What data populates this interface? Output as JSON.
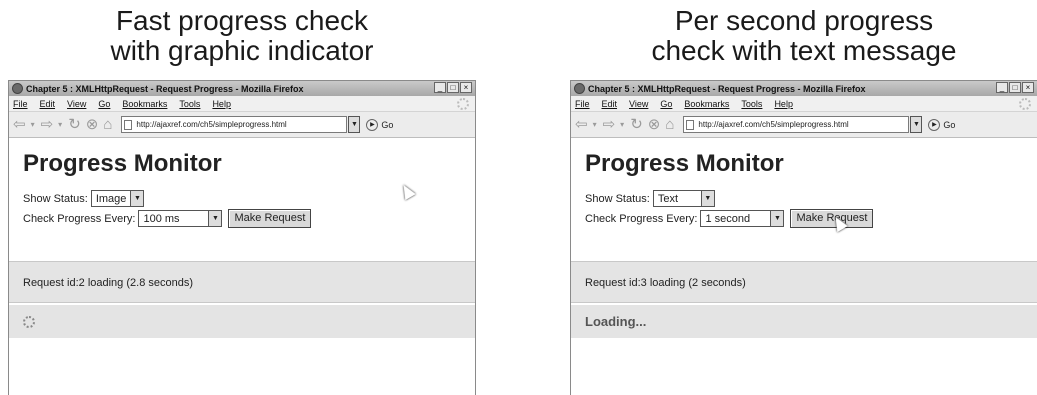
{
  "left": {
    "caption": [
      "Fast progress check",
      "with graphic indicator"
    ],
    "window_title": "Chapter 5 : XMLHttpRequest - Request Progress - Mozilla Firefox",
    "menu": [
      "File",
      "Edit",
      "View",
      "Go",
      "Bookmarks",
      "Tools",
      "Help"
    ],
    "url": "http://ajaxref.com/ch5/simpleprogress.html",
    "go_label": "Go",
    "heading": "Progress Monitor",
    "show_status_label": "Show Status:",
    "show_status_value": "Image",
    "check_label": "Check Progress Every:",
    "check_value": "100 ms",
    "button_label": "Make Request",
    "status_message": "Request id:2 loading (2.8 seconds)",
    "indicator": "spinner-icon"
  },
  "right": {
    "caption": [
      "Per second progress",
      "check with text message"
    ],
    "window_title": "Chapter 5 : XMLHttpRequest - Request Progress - Mozilla Firefox",
    "menu": [
      "File",
      "Edit",
      "View",
      "Go",
      "Bookmarks",
      "Tools",
      "Help"
    ],
    "url": "http://ajaxref.com/ch5/simpleprogress.html",
    "go_label": "Go",
    "heading": "Progress Monitor",
    "show_status_label": "Show Status:",
    "show_status_value": "Text",
    "check_label": "Check Progress Every:",
    "check_value": "1 second",
    "button_label": "Make Request",
    "status_message": "Request id:3 loading (2 seconds)",
    "loading_text": "Loading..."
  }
}
